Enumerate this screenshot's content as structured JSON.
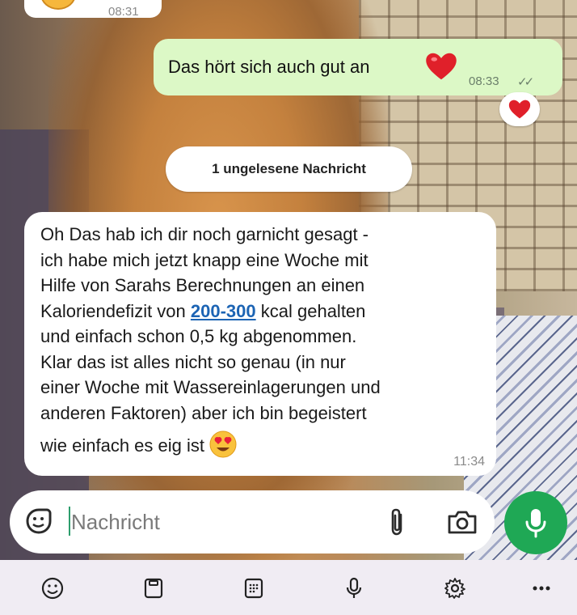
{
  "chat": {
    "prev_incoming_time": "08:31",
    "outgoing": {
      "text": "Das hört sich auch gut an",
      "time": "08:33",
      "status": "read",
      "reaction_icon": "heart-emoji"
    },
    "unread_banner": "1 ungelesene Nachricht",
    "incoming": {
      "lines": [
        "Oh Das hab ich dir noch garnicht gesagt -",
        "ich habe mich jetzt knapp eine Woche mit",
        "Hilfe von Sarahs Berechnungen an einen"
      ],
      "line4_pre": "Kaloriendefizit von ",
      "line4_link": "200-300",
      "line4_post": " kcal gehalten",
      "lines_after": [
        "und einfach schon 0,5 kg abgenommen.",
        "Klar das ist alles nicht so genau (in nur",
        "einer Woche mit Wassereinlagerungen und",
        "anderen Faktoren) aber ich bin begeistert"
      ],
      "last_line": "wie einfach es eig ist ",
      "emoji": "heart-eyes-emoji",
      "time": "11:34"
    }
  },
  "composer": {
    "placeholder": "Nachricht",
    "icons": [
      "sticker-icon",
      "attach-icon",
      "camera-icon",
      "mic-icon"
    ]
  },
  "keyboard_toolbar": {
    "icons": [
      "emoji-icon",
      "clipboard-icon",
      "keypad-icon",
      "voice-input-icon",
      "settings-icon",
      "more-icon"
    ]
  },
  "colors": {
    "outgoing_bubble": "#dcf8c6",
    "link": "#1c64b4",
    "mic_button": "#1fa855",
    "caret": "#2c9d6c"
  }
}
